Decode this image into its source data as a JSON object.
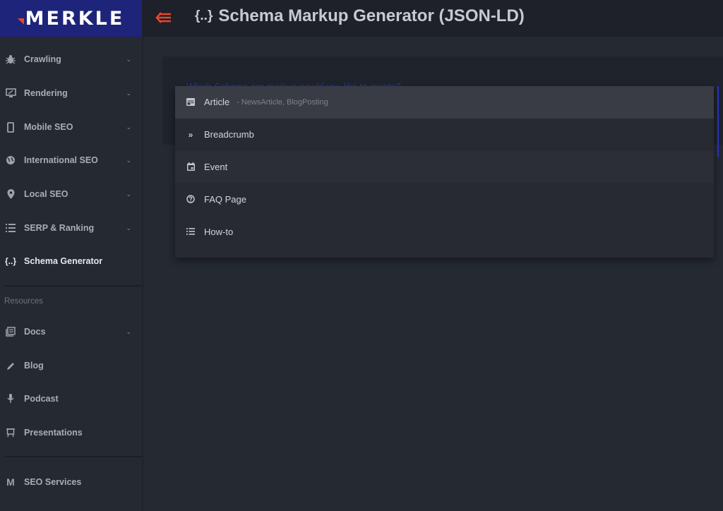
{
  "header": {
    "logo_text": "MERKLE",
    "collapse_icon": "menu-collapse-arrow-icon",
    "title_icon": "{..}",
    "title": "Schema Markup Generator (JSON-LD)"
  },
  "sidebar": {
    "items": [
      {
        "label": "Crawling",
        "icon": "bug-icon",
        "expandable": true
      },
      {
        "label": "Rendering",
        "icon": "monitor-icon",
        "expandable": true
      },
      {
        "label": "Mobile SEO",
        "icon": "phone-icon",
        "expandable": true
      },
      {
        "label": "International SEO",
        "icon": "globe-icon",
        "expandable": true
      },
      {
        "label": "Local SEO",
        "icon": "map-pin-icon",
        "expandable": true
      },
      {
        "label": "SERP & Ranking",
        "icon": "list-icon",
        "expandable": true
      },
      {
        "label": "Schema Generator",
        "icon": "braces-icon",
        "expandable": false,
        "active": true
      }
    ],
    "resources_label": "Resources",
    "resources": [
      {
        "label": "Docs",
        "icon": "docs-icon",
        "expandable": true
      },
      {
        "label": "Blog",
        "icon": "pencil-icon",
        "expandable": false
      },
      {
        "label": "Podcast",
        "icon": "microphone-icon",
        "expandable": false
      },
      {
        "label": "Presentations",
        "icon": "easel-icon",
        "expandable": false
      }
    ],
    "footer": {
      "label": "SEO Services",
      "icon": "merkle-m-icon"
    },
    "chevron": "⌄"
  },
  "main": {
    "question_label": "Which Schema.org markup would you like to create?",
    "dropdown": {
      "options": [
        {
          "label": "Article",
          "sub": "- NewsArticle, BlogPosting",
          "icon": "article-icon"
        },
        {
          "label": "Breadcrumb",
          "sub": "",
          "icon": "double-chevron-icon"
        },
        {
          "label": "Event",
          "sub": "",
          "icon": "calendar-icon"
        },
        {
          "label": "FAQ Page",
          "sub": "",
          "icon": "question-circle-icon"
        },
        {
          "label": "How-to",
          "sub": "",
          "icon": "list-icon"
        }
      ]
    }
  },
  "colors": {
    "brand_blue": "#1d247a",
    "accent_orange": "#e8452b"
  }
}
